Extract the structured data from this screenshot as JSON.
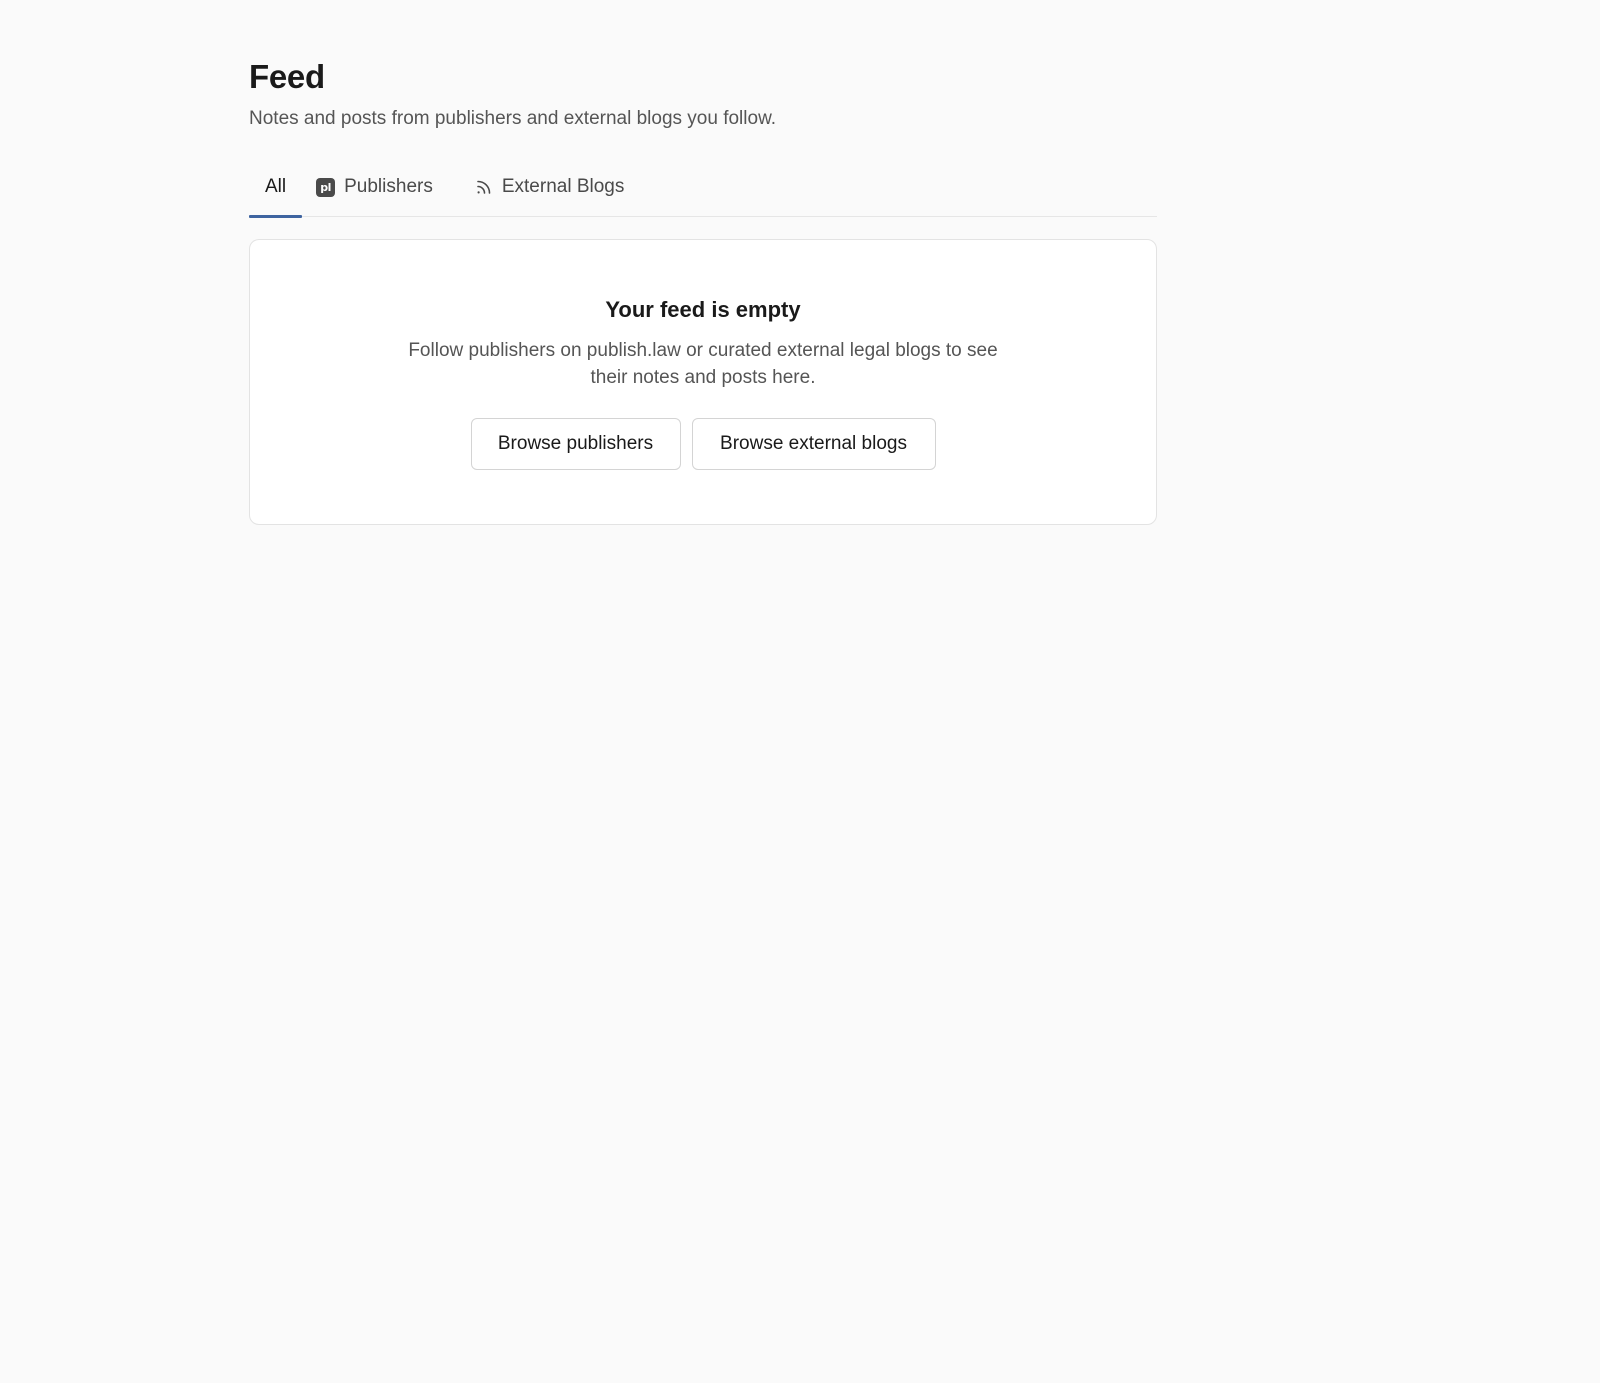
{
  "header": {
    "title": "Feed",
    "subtitle": "Notes and posts from publishers and external blogs you follow."
  },
  "tabs": [
    {
      "label": "All",
      "active": true,
      "icon": ""
    },
    {
      "label": "Publishers",
      "active": false,
      "icon": "publish-law-logo-icon"
    },
    {
      "label": "External Blogs",
      "active": false,
      "icon": "rss-icon"
    }
  ],
  "icons": {
    "publisher_glyph": "pl"
  },
  "empty_state": {
    "title": "Your feed is empty",
    "description": "Follow publishers on publish.law or curated external legal blogs to see their notes and posts here.",
    "primary_button": "Browse publishers",
    "secondary_button": "Browse external blogs"
  },
  "colors": {
    "background": "#fafafa",
    "active_tab_underline": "#3e64a0",
    "card_background": "#ffffff"
  }
}
